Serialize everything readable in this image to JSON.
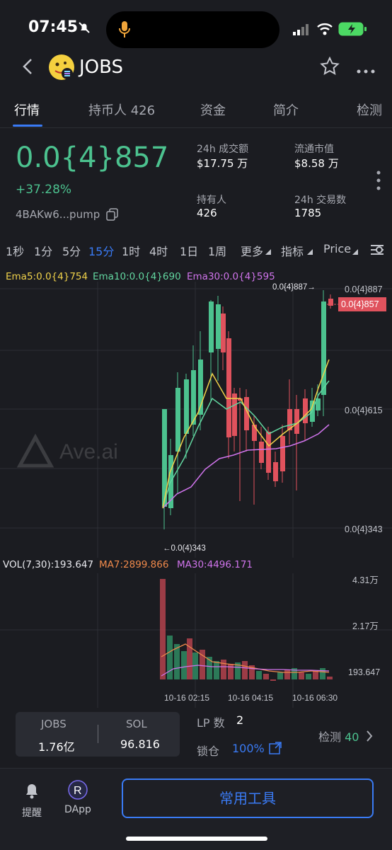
{
  "status_bar": {
    "time": "07:45"
  },
  "header": {
    "title": "JOBS"
  },
  "tabs": [
    {
      "label": "行情"
    },
    {
      "label": "持币人 426"
    },
    {
      "label": "资金"
    },
    {
      "label": "简介"
    },
    {
      "label": "检测"
    }
  ],
  "token": {
    "price": "0.0{4}857",
    "change": "+37.28%",
    "address": "4BAKw6...pump"
  },
  "stats": [
    {
      "label": "24h 成交额",
      "value": "$17.75 万"
    },
    {
      "label": "流通市值",
      "value": "$8.58 万"
    },
    {
      "label": "持有人",
      "value": "426"
    },
    {
      "label": "24h 交易数",
      "value": "1785"
    }
  ],
  "intervals": [
    "1秒",
    "1分",
    "5分",
    "15分",
    "1时",
    "4时",
    "1日",
    "1周",
    "更多",
    "指标",
    "Price"
  ],
  "active_interval": "15分",
  "indicators": {
    "ema5": "Ema5:0.0{4}754",
    "ema10": "Ema10:0.0{4}690",
    "ema30": "Ema30:0.0{4}595"
  },
  "chart_data": {
    "type": "candlestick",
    "y_axis_labels": [
      "0.0{4}887",
      "0.0{4}615",
      "0.0{4}343"
    ],
    "current_price_label": "0.0{4}857",
    "high_marker": "0.0{4}887→",
    "low_marker": "←0.0(4)343",
    "x_labels": [
      "10-16 02:15",
      "10-16 04:15",
      "10-16 06:30"
    ],
    "volume": {
      "header": "VOL(7,30):193.647",
      "ma7": "MA7:2899.866",
      "ma30": "MA30:4496.171",
      "y_labels": [
        "4.31万",
        "2.17万",
        "193.647"
      ]
    },
    "watermark": "Ave.ai"
  },
  "balances": {
    "left_label": "JOBS",
    "left_value": "1.76亿",
    "right_label": "SOL",
    "right_value": "96.816"
  },
  "lp": {
    "label": "LP 数",
    "value": "2"
  },
  "lock": {
    "label": "锁仓",
    "value": "100%"
  },
  "check": {
    "label": "检测",
    "value": "40"
  },
  "footer": {
    "alert_label": "提醒",
    "dapp_label": "DApp",
    "tools_label": "常用工具"
  },
  "colors": {
    "up": "#4cc28f",
    "down": "#e0525d",
    "accent": "#3a7bf5",
    "ema5": "#f0d24a",
    "ema10": "#62d6a0",
    "ema30": "#d074ec"
  }
}
